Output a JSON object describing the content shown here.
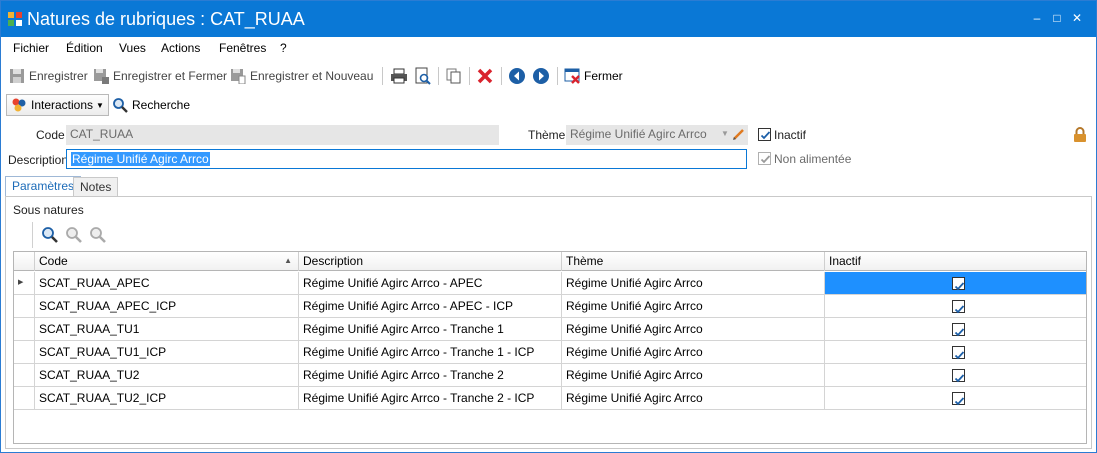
{
  "window": {
    "title": "Natures de rubriques : CAT_RUAA",
    "controls": {
      "minimize": "‒",
      "maximize": "□",
      "close": "✕"
    }
  },
  "menu": [
    "Fichier",
    "Édition",
    "Vues",
    "Actions",
    "Fenêtres",
    "?"
  ],
  "toolbar": {
    "save_label": "Enregistrer",
    "save_close_label": "Enregistrer et Fermer",
    "save_new_label": "Enregistrer et Nouveau",
    "close_label": "Fermer"
  },
  "actions": {
    "interactions_label": "Interactions",
    "search_label": "Recherche"
  },
  "form": {
    "code_label": "Code",
    "code_value": "CAT_RUAA",
    "theme_label": "Thème",
    "theme_value": "Régime Unifié Agirc Arrco",
    "description_label": "Description",
    "description_value": "Régime Unifié Agirc Arrco",
    "inactive_label": "Inactif",
    "inactive_checked": true,
    "not_fed_label": "Non alimentée",
    "not_fed_checked": true
  },
  "tabs": [
    {
      "label": "Paramètres",
      "active": true
    },
    {
      "label": "Notes",
      "active": false
    }
  ],
  "sub_natures": {
    "title": "Sous natures",
    "columns": [
      "Code",
      "Description",
      "Thème",
      "Inactif"
    ],
    "rows": [
      {
        "code": "SCAT_RUAA_APEC",
        "description": "Régime Unifié Agirc Arrco - APEC",
        "theme": "Régime Unifié Agirc Arrco",
        "inactive": true
      },
      {
        "code": "SCAT_RUAA_APEC_ICP",
        "description": "Régime Unifié Agirc Arrco - APEC - ICP",
        "theme": "Régime Unifié Agirc Arrco",
        "inactive": true
      },
      {
        "code": "SCAT_RUAA_TU1",
        "description": "Régime Unifié Agirc Arrco - Tranche 1",
        "theme": "Régime Unifié Agirc Arrco",
        "inactive": true
      },
      {
        "code": "SCAT_RUAA_TU1_ICP",
        "description": "Régime Unifié Agirc Arrco - Tranche 1 - ICP",
        "theme": "Régime Unifié Agirc Arrco",
        "inactive": true
      },
      {
        "code": "SCAT_RUAA_TU2",
        "description": "Régime Unifié Agirc Arrco - Tranche 2",
        "theme": "Régime Unifié Agirc Arrco",
        "inactive": true
      },
      {
        "code": "SCAT_RUAA_TU2_ICP",
        "description": "Régime Unifié Agirc Arrco - Tranche 2 - ICP",
        "theme": "Régime Unifié Agirc Arrco",
        "inactive": true
      }
    ]
  },
  "colors": {
    "titlebar": "#0a78d6",
    "selection": "#1e90ff",
    "delete": "#d9232d"
  }
}
